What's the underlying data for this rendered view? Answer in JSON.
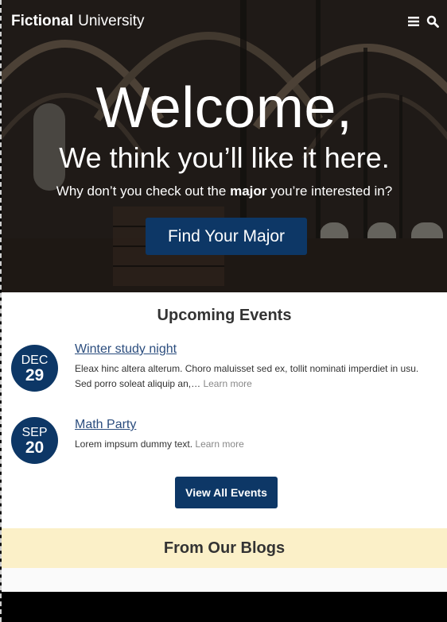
{
  "header": {
    "logo_strong": "Fictional",
    "logo_light": "University",
    "menu_icon": "menu-icon",
    "search_icon": "search-icon"
  },
  "hero": {
    "title": "Welcome,",
    "subtitle": "We think you’ll like it here.",
    "tagline_before": "Why don’t you check out the",
    "tagline_bold": "major",
    "tagline_after": "you’re interested in?",
    "cta": "Find Your Major"
  },
  "events": {
    "title": "Upcoming Events",
    "items": [
      {
        "month": "DEC",
        "day": "29",
        "title": "Winter study night",
        "description": "Eleax hinc altera alterum. Choro maluisset sed ex, tollit nominati imperdiet in usu. Sed porro soleat aliquip an,…",
        "more": "Learn more"
      },
      {
        "month": "SEP",
        "day": "20",
        "title": "Math Party",
        "description": "Lorem impsum dummy text.",
        "more": "Learn more"
      }
    ],
    "view_all": "View All Events"
  },
  "blogs": {
    "title": "From Our Blogs"
  },
  "colors": {
    "brand_blue": "#0d3766",
    "link_blue": "#2b4d7e",
    "blog_bar": "#fbf0c8"
  }
}
